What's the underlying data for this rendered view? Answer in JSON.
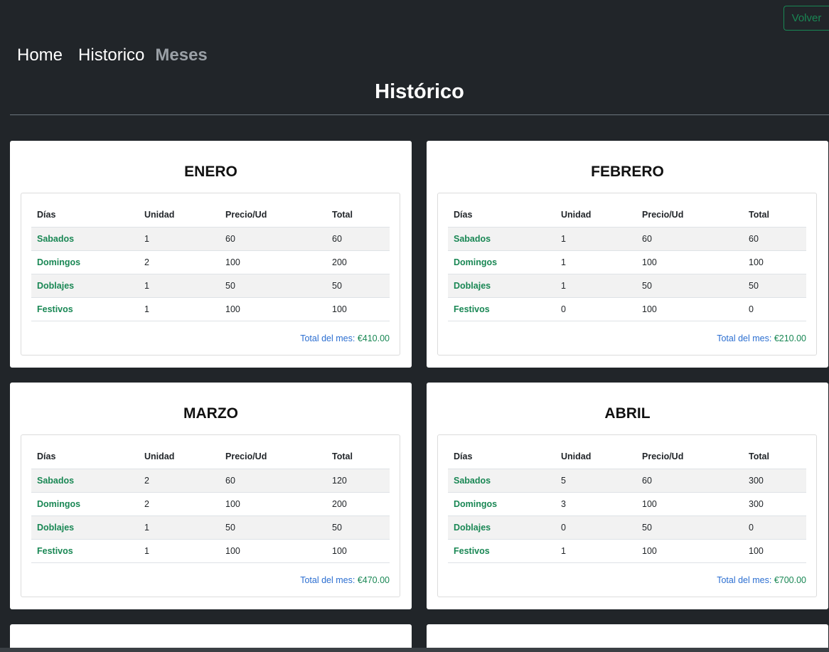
{
  "header": {
    "volver_label": "Volver"
  },
  "nav": {
    "home": "Home",
    "historico": "Historico",
    "meses": "Meses"
  },
  "page_title": "Histórico",
  "table_headers": {
    "dias": "Días",
    "unidad": "Unidad",
    "precio": "Precio/Ud",
    "total": "Total"
  },
  "total_label": "Total del mes: ",
  "months": [
    {
      "name": "ENERO",
      "rows": [
        {
          "dia": "Sabados",
          "unidad": "1",
          "precio": "60",
          "total": "60"
        },
        {
          "dia": "Domingos",
          "unidad": "2",
          "precio": "100",
          "total": "200"
        },
        {
          "dia": "Doblajes",
          "unidad": "1",
          "precio": "50",
          "total": "50"
        },
        {
          "dia": "Festivos",
          "unidad": "1",
          "precio": "100",
          "total": "100"
        }
      ],
      "total_amount": "€410.00"
    },
    {
      "name": "FEBRERO",
      "rows": [
        {
          "dia": "Sabados",
          "unidad": "1",
          "precio": "60",
          "total": "60"
        },
        {
          "dia": "Domingos",
          "unidad": "1",
          "precio": "100",
          "total": "100"
        },
        {
          "dia": "Doblajes",
          "unidad": "1",
          "precio": "50",
          "total": "50"
        },
        {
          "dia": "Festivos",
          "unidad": "0",
          "precio": "100",
          "total": "0"
        }
      ],
      "total_amount": "€210.00"
    },
    {
      "name": "MARZO",
      "rows": [
        {
          "dia": "Sabados",
          "unidad": "2",
          "precio": "60",
          "total": "120"
        },
        {
          "dia": "Domingos",
          "unidad": "2",
          "precio": "100",
          "total": "200"
        },
        {
          "dia": "Doblajes",
          "unidad": "1",
          "precio": "50",
          "total": "50"
        },
        {
          "dia": "Festivos",
          "unidad": "1",
          "precio": "100",
          "total": "100"
        }
      ],
      "total_amount": "€470.00"
    },
    {
      "name": "ABRIL",
      "rows": [
        {
          "dia": "Sabados",
          "unidad": "5",
          "precio": "60",
          "total": "300"
        },
        {
          "dia": "Domingos",
          "unidad": "3",
          "precio": "100",
          "total": "300"
        },
        {
          "dia": "Doblajes",
          "unidad": "0",
          "precio": "50",
          "total": "0"
        },
        {
          "dia": "Festivos",
          "unidad": "1",
          "precio": "100",
          "total": "100"
        }
      ],
      "total_amount": "€700.00"
    }
  ]
}
